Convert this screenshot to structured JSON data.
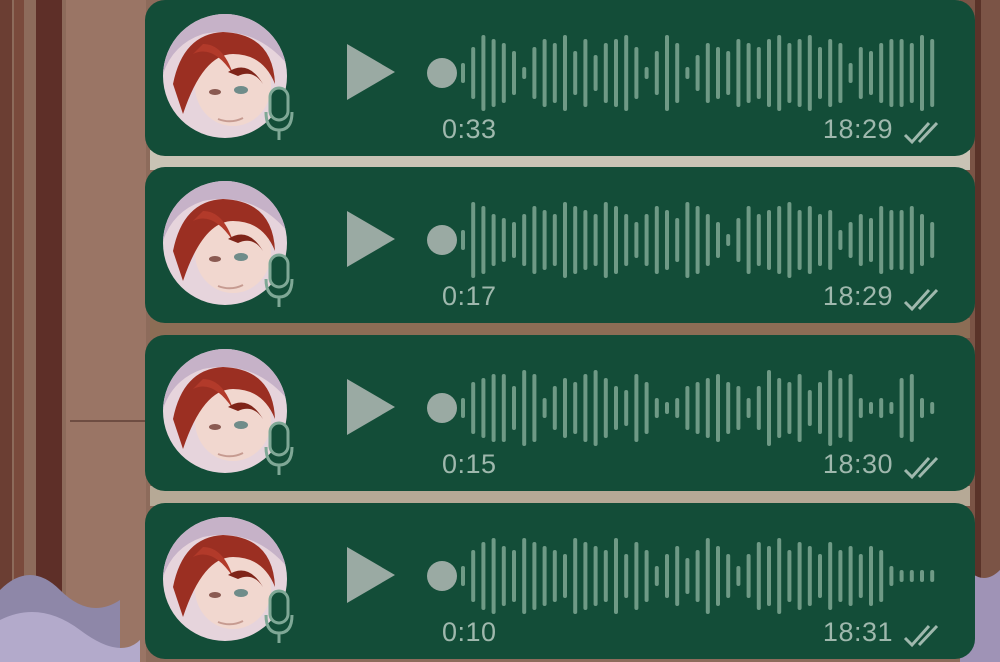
{
  "colors": {
    "bubble": "#134d38",
    "waveform": "#6f9a86",
    "text": "#9fb8ad",
    "play": "#9aaaa3"
  },
  "icons": {
    "play": "play-icon",
    "mic": "microphone-icon",
    "ticks": "double-check-icon"
  },
  "messages": [
    {
      "duration": "0:33",
      "time": "18:29"
    },
    {
      "duration": "0:17",
      "time": "18:29"
    },
    {
      "duration": "0:15",
      "time": "18:30"
    },
    {
      "duration": "0:10",
      "time": "18:31"
    }
  ]
}
